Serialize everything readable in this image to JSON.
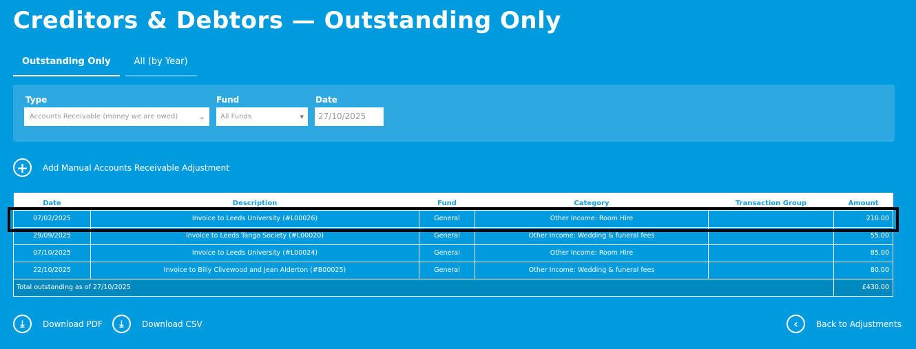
{
  "title": "Creditors & Debtors — Outstanding Only",
  "tabs": [
    {
      "label": "Outstanding Only"
    },
    {
      "label": "All (by Year)"
    }
  ],
  "filters": {
    "type_label": "Type",
    "type_value": "Accounts Receivable (money we are owed)",
    "fund_label": "Fund",
    "fund_value": "All Funds",
    "date_label": "Date",
    "date_value": "27/10/2025"
  },
  "add_label": "Add Manual Accounts Receivable Adjustment",
  "table": {
    "headers": [
      "Date",
      "Description",
      "Fund",
      "Category",
      "Transaction Group",
      "Amount"
    ],
    "rows": [
      [
        "07/02/2025",
        "Invoice to Leeds University (#L00026)",
        "General",
        "Other Income: Room Hire",
        "",
        "210.00"
      ],
      [
        "29/09/2025",
        "Invoice to Leeds Tango Society (#L00020)",
        "General",
        "Other Income: Wedding & funeral fees",
        "",
        "55.00"
      ],
      [
        "07/10/2025",
        "Invoice to Leeds University (#L00024)",
        "General",
        "Other Income: Room Hire",
        "",
        "85.00"
      ],
      [
        "22/10/2025",
        "Invoice to Billy Clivewood and Jean Alderton (#B00025)",
        "General",
        "Other Income: Wedding & funeral fees",
        "",
        "80.00"
      ]
    ],
    "total_label": "Total outstanding as of 27/10/2025",
    "total_value": "£430.00"
  },
  "footer": {
    "pdf": "Download PDF",
    "csv": "Download CSV",
    "back": "Back to Adjustments"
  }
}
